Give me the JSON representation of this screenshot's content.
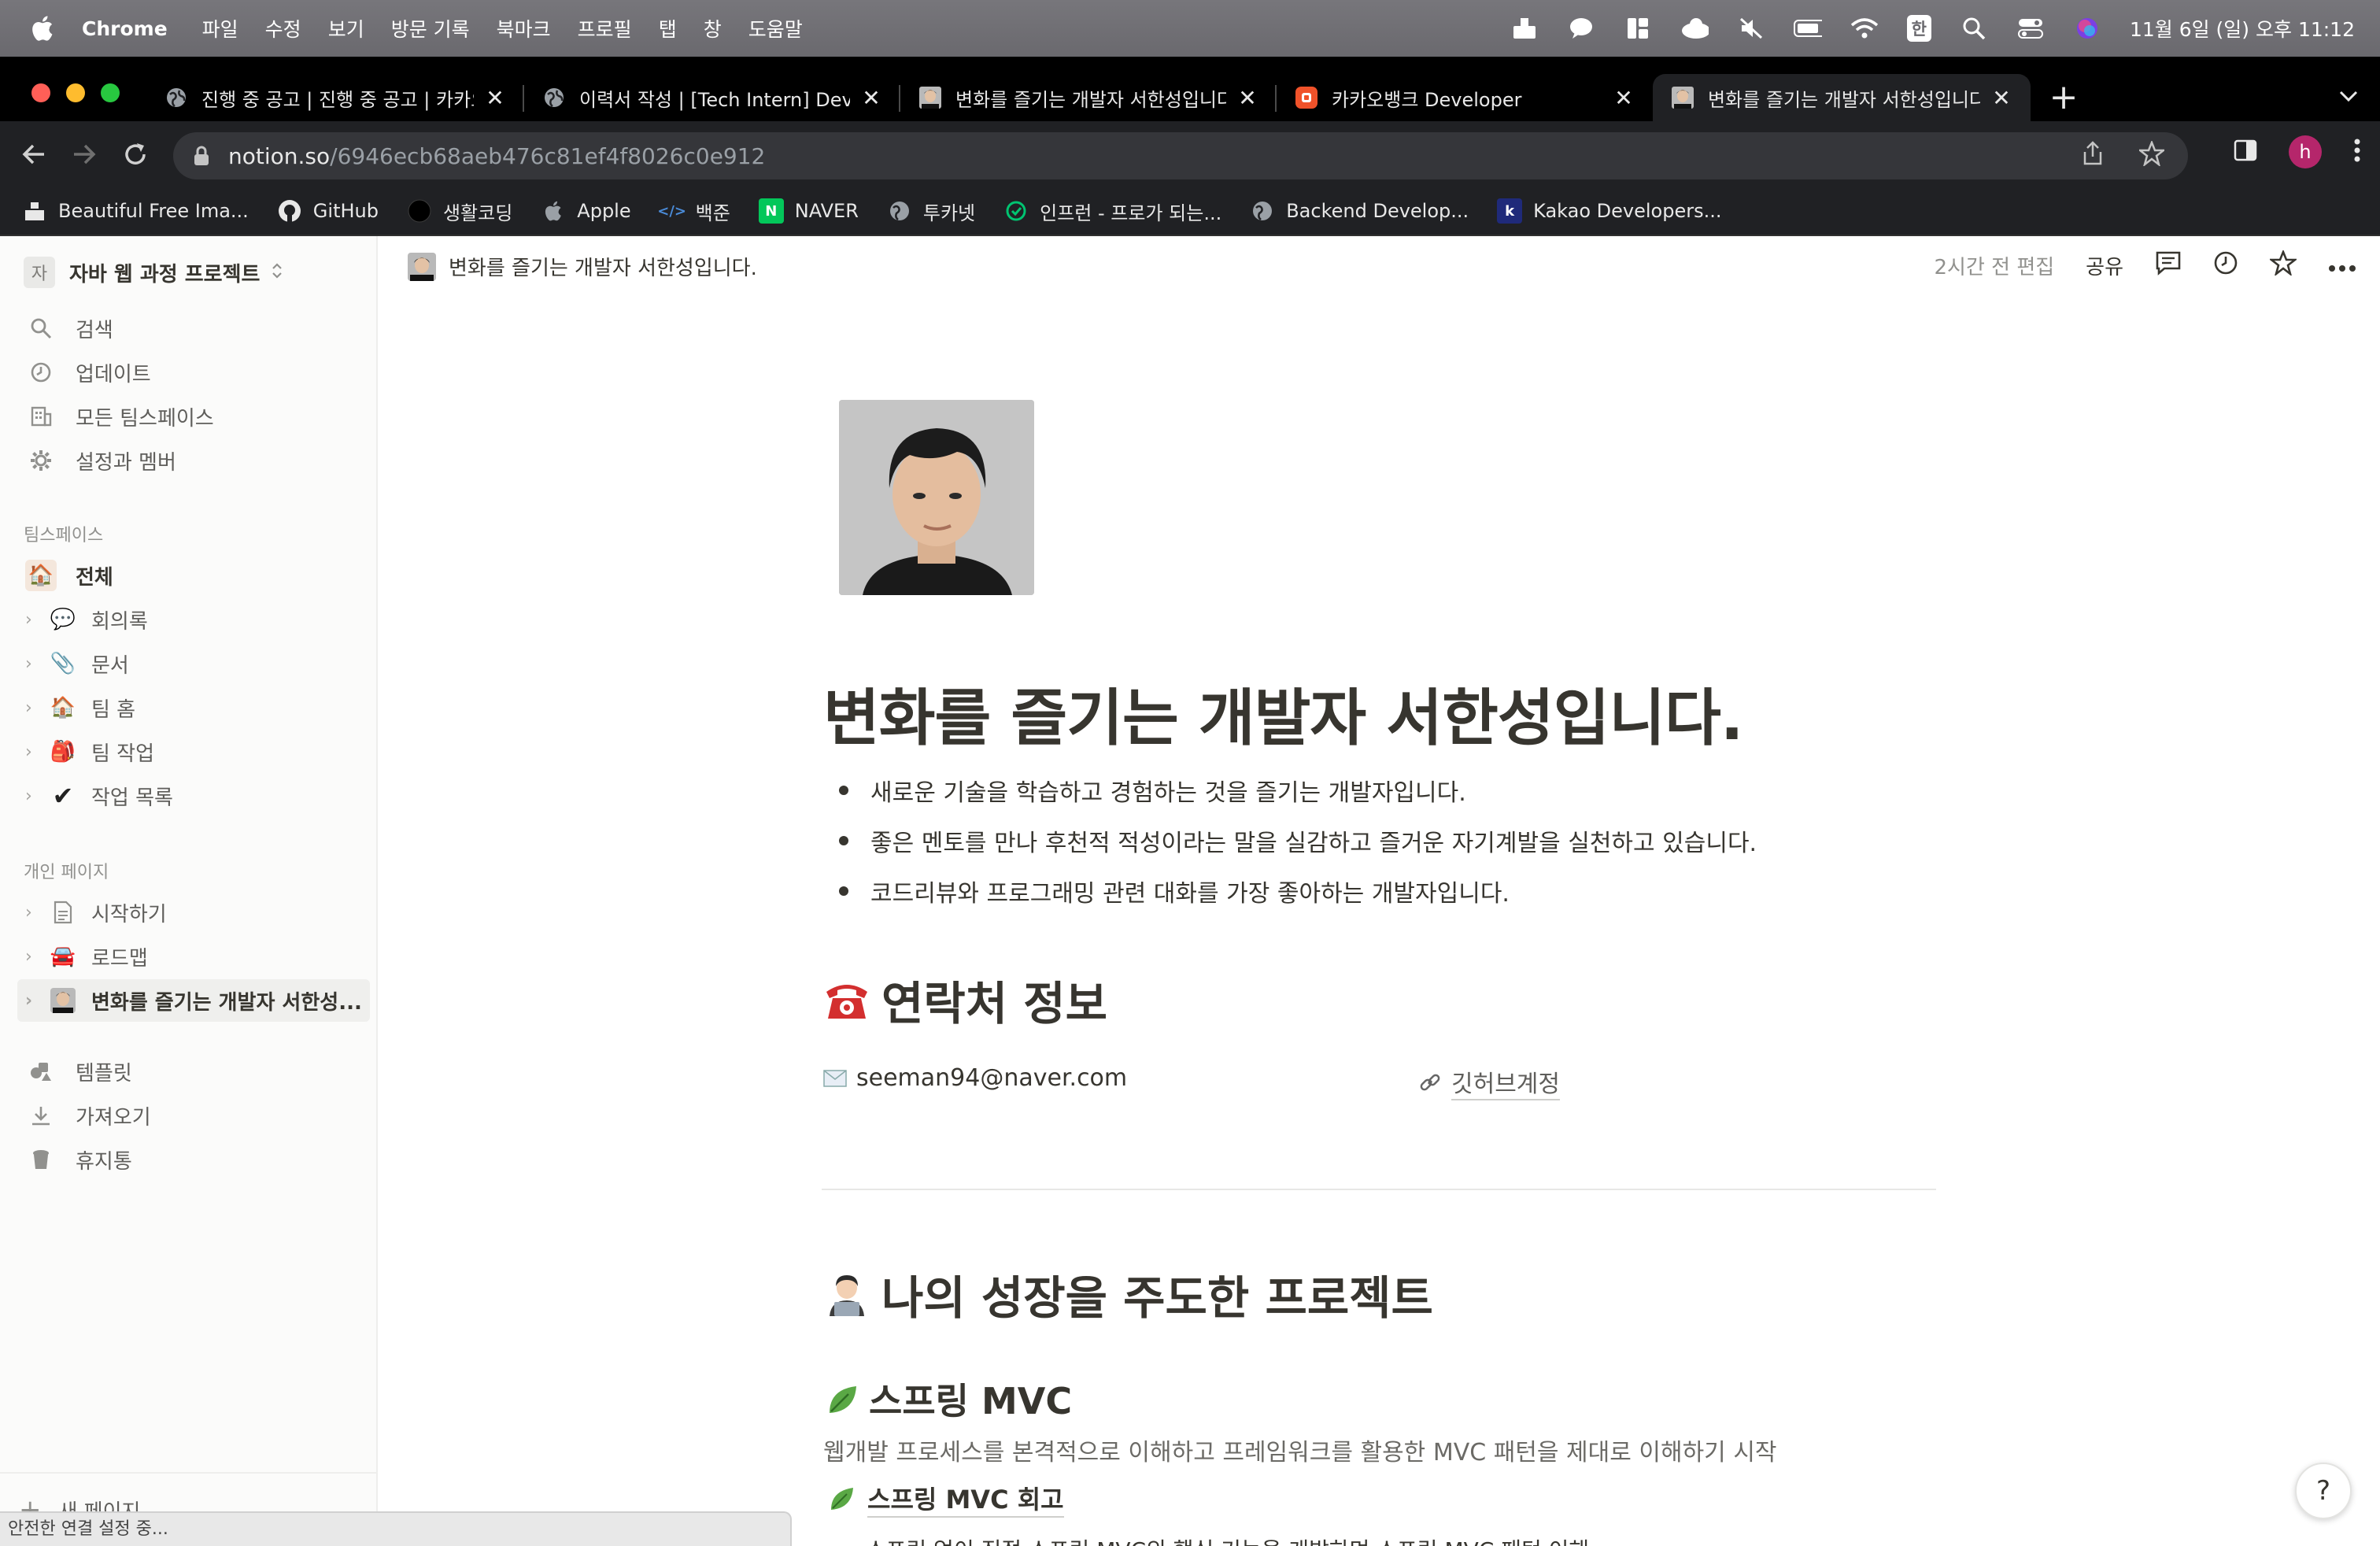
{
  "menubar": {
    "app": "Chrome",
    "items": [
      "파일",
      "수정",
      "보기",
      "방문 기록",
      "북마크",
      "프로필",
      "탭",
      "창",
      "도움말"
    ],
    "ime": "한",
    "clock": "11월 6일 (일) 오후 11:12"
  },
  "tabs": [
    {
      "title": "진행 중 공고 | 진행 중 공고 | 카카오뱅크",
      "icon": "globe-icon"
    },
    {
      "title": "이력서 작성 | [Tech Intern] Developer",
      "icon": "globe-icon"
    },
    {
      "title": "변화를 즐기는 개발자 서한성입니다.",
      "icon": "portrait-icon"
    },
    {
      "title": "카카오뱅크 Developer",
      "icon": "kakaobank-icon"
    },
    {
      "title": "변화를 즐기는 개발자 서한성입니다.",
      "icon": "portrait-icon",
      "active": true
    }
  ],
  "toolbar": {
    "url_domain": "notion.so",
    "url_path": "/6946ecb68aeb476c81ef4f8026c0e912",
    "profile_initial": "h"
  },
  "bookmarks": [
    {
      "label": "Beautiful Free Ima...",
      "icon": "unsplash-icon"
    },
    {
      "label": "GitHub",
      "icon": "github-icon"
    },
    {
      "label": "생활코딩",
      "icon": "circle-icon"
    },
    {
      "label": "Apple",
      "icon": "apple-icon"
    },
    {
      "label": "백준",
      "icon": "code-icon"
    },
    {
      "label": "NAVER",
      "icon": "naver-icon"
    },
    {
      "label": "투카넷",
      "icon": "globe-icon"
    },
    {
      "label": "인프런 - 프로가 되는...",
      "icon": "inflearn-icon"
    },
    {
      "label": "Backend Develop...",
      "icon": "globe-icon"
    },
    {
      "label": "Kakao Developers...",
      "icon": "kakao-k-icon"
    }
  ],
  "sidebar": {
    "workspace_icon": "자",
    "workspace": "자바 웹 과정 프로젝트",
    "nav": [
      {
        "label": "검색",
        "icon": "search-icon"
      },
      {
        "label": "업데이트",
        "icon": "clock-icon"
      },
      {
        "label": "모든 팀스페이스",
        "icon": "building-icon"
      },
      {
        "label": "설정과 멤버",
        "icon": "gear-icon"
      }
    ],
    "teamspace_header": "팀스페이스",
    "teamspace_all": "전체",
    "teamspace_pages": [
      {
        "label": "회의록",
        "emoji": "💬"
      },
      {
        "label": "문서",
        "emoji": "📎"
      },
      {
        "label": "팀 홈",
        "emoji": "🏠"
      },
      {
        "label": "팀 작업",
        "emoji": "🎒"
      },
      {
        "label": "작업 목록",
        "emoji": "✔"
      }
    ],
    "private_header": "개인 페이지",
    "private_pages": [
      {
        "label": "시작하기",
        "icon": "document-icon"
      },
      {
        "label": "로드맵",
        "emoji": "🚘"
      },
      {
        "label": "변화를 즐기는 개발자 서한성...",
        "icon": "portrait-icon"
      }
    ],
    "bottom": [
      {
        "label": "템플릿",
        "icon": "template-icon"
      },
      {
        "label": "가져오기",
        "icon": "download-icon"
      },
      {
        "label": "휴지통",
        "icon": "trash-icon"
      }
    ],
    "new_page": "새 페이지",
    "status": "안전한 연결 설정 중..."
  },
  "topbar": {
    "breadcrumb": "변화를 즐기는 개발자 서한성입니다.",
    "edited": "2시간 전 편집",
    "share": "공유"
  },
  "page": {
    "title": "변화를 즐기는 개발자 서한성입니다.",
    "bullets": [
      "새로운 기술을 학습하고 경험하는 것을 즐기는 개발자입니다.",
      "좋은 멘토를 만나 후천적 적성이라는 말을 실감하고 즐거운 자기계발을 실천하고 있습니다.",
      "코드리뷰와 프로그래밍 관련 대화를 가장 좋아하는 개발자입니다."
    ],
    "contact_heading": "연락처 정보",
    "email": "seeman94@naver.com",
    "github": "깃허브계정",
    "projects_heading": "나의 성장을 주도한 프로젝트",
    "project1_title": "스프링 MVC",
    "project1_desc": "웹개발 프로세스를 본격적으로 이해하고 프레임워크를 활용한 MVC 패턴을 제대로 이해하기 시작",
    "project1_link": "스프링 MVC 회고",
    "project1_cutoff": "스프링 없이 직접 스프링 MVC의 핵심 기능을 개발하며 스프링 MVC 패턴 이해"
  },
  "help": "?"
}
